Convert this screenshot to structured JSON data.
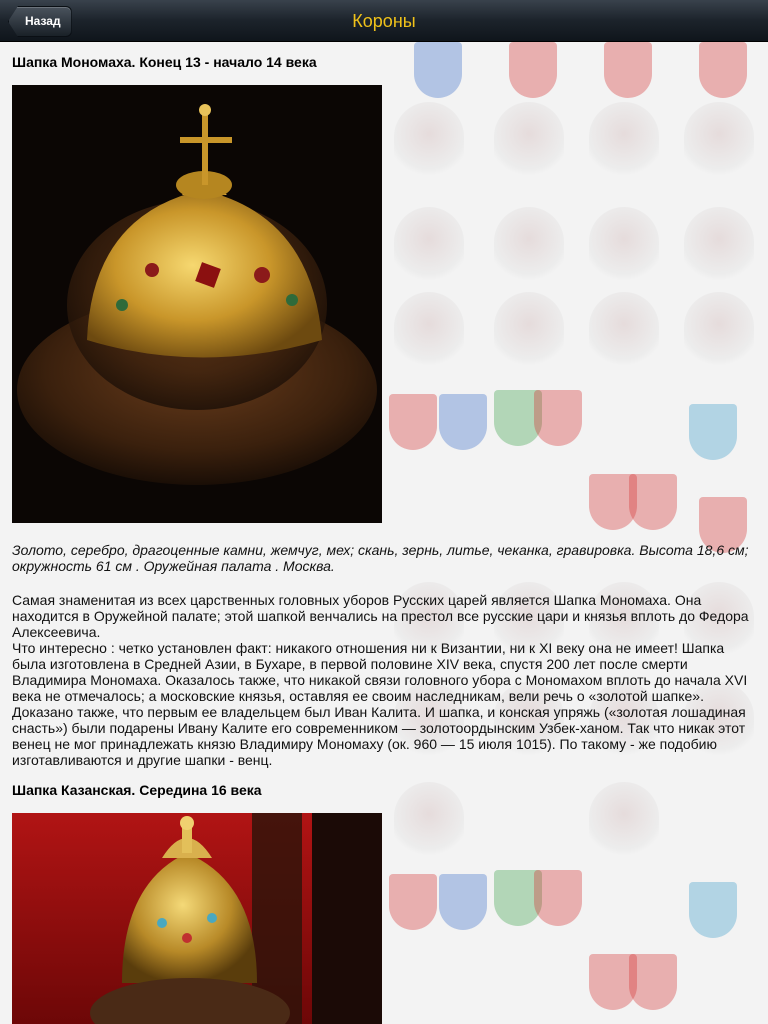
{
  "navbar": {
    "back_label": "Назад",
    "title": "Короны"
  },
  "sections": [
    {
      "heading": "Шапка Мономаха. Конец 13 - начало 14 века",
      "image": "monomakh-cap-photo",
      "caption": "Золото, серебро, драгоценные камни, жемчуг, мех; скань, зернь, литье, чеканка, гравировка. Высота 18,6 см; окружность 61 см . Оружейная палата . Москва.",
      "text": "   Самая знаменитая из всех царственных головных уборов Русских царей является Шапка Мономаха. Она находится в Оружейной палате; этой шапкой венчались на престол все русские цари и князья вплоть до Федора Алексеевича.\n   Что интересно : четко установлен факт: никакого отношения ни к Византии, ни к XI веку она не имеет! Шапка была изготовлена в Средней Азии, в Бухаре, в первой половине XIV века, спустя 200 лет после смерти Владимира Мономаха. Оказалось также, что никакой связи головного убора с Мономахом вплоть до начала XVI века не отмечалось; а московские князья, оставляя ее своим наследникам, вели речь о «золотой шапке». Доказано также, что первым ее владельцем был Иван Калита. И шапка, и конская упряжь («золотая лошадиная снасть») были подарены Ивану Калите его современником — золотоордынским Узбек-ханом. Так что никак этот венец не мог принадлежать князю Владимиру Мономаху (ок. 960 — 15 июля 1015). По такому - же подобию изготавливаются и другие шапки - венц."
    },
    {
      "heading": "Шапка Казанская. Середина 16 века",
      "image": "kazan-cap-photo"
    }
  ],
  "colors": {
    "title": "#f0c21a",
    "navbar": "#1c232b"
  }
}
